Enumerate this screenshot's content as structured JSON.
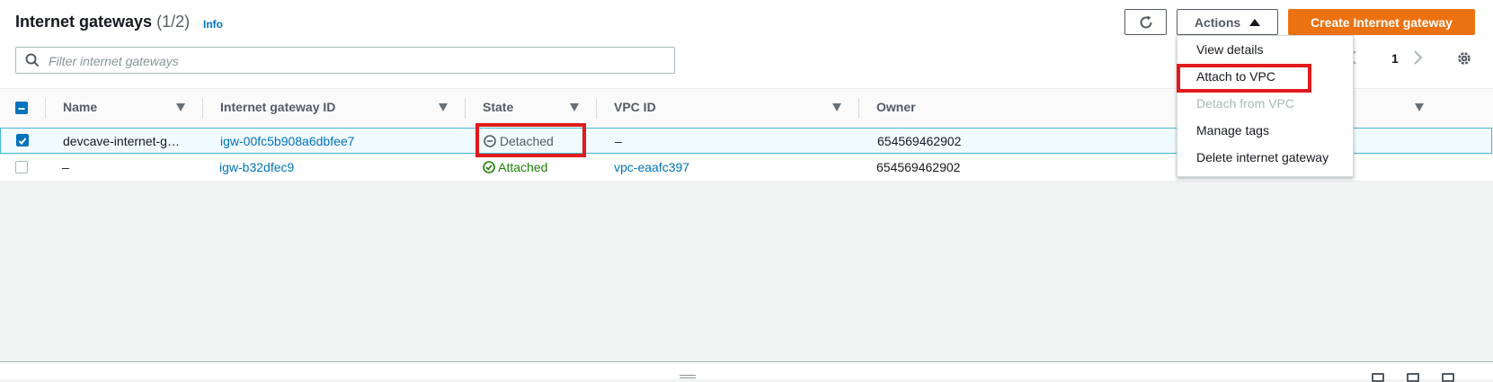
{
  "header": {
    "title": "Internet gateways",
    "count": "(1/2)",
    "info": "Info"
  },
  "toolbar": {
    "refresh_icon": "refresh-icon",
    "actions_label": "Actions",
    "create_label": "Create Internet gateway",
    "create_color": "#ec7211"
  },
  "search": {
    "placeholder": "Filter internet gateways",
    "value": ""
  },
  "pagination": {
    "page": "1"
  },
  "columns": [
    "Name",
    "Internet gateway ID",
    "State",
    "VPC ID",
    "Owner"
  ],
  "rows": [
    {
      "selected": true,
      "name": "devcave-internet-g…",
      "id": "igw-00fc5b908a6dbfee7",
      "state": "Detached",
      "vpc": "–",
      "owner": "654569462902"
    },
    {
      "selected": false,
      "name": "–",
      "id": "igw-b32dfec9",
      "state": "Attached",
      "vpc": "vpc-eaafc397",
      "owner": "654569462902"
    }
  ],
  "actions_menu": {
    "items": [
      {
        "label": "View details",
        "disabled": false
      },
      {
        "label": "Attach to VPC",
        "disabled": false
      },
      {
        "label": "Detach from VPC",
        "disabled": true
      },
      {
        "label": "Manage tags",
        "disabled": false
      },
      {
        "label": "Delete internet gateway",
        "disabled": false
      }
    ]
  },
  "colors": {
    "link": "#0073bb",
    "attached": "#1d8102",
    "highlight": "#e01b1b"
  }
}
